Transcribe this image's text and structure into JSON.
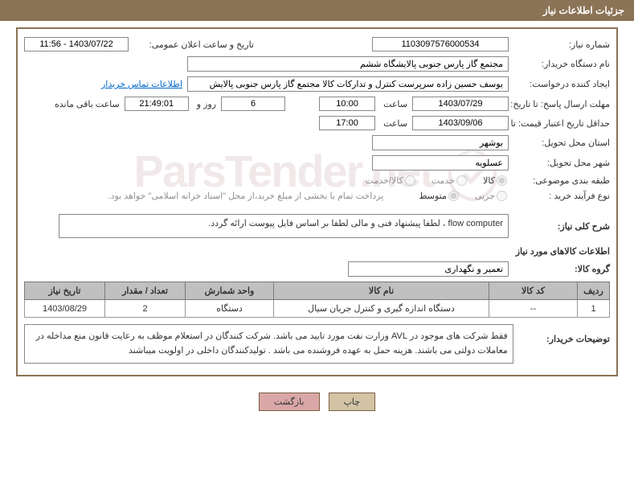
{
  "header": "جزئیات اطلاعات نیاز",
  "labels": {
    "req_no": "شماره نیاز:",
    "announce": "تاریخ و ساعت اعلان عمومی:",
    "buyer_org": "نام دستگاه خریدار:",
    "creator": "ایجاد کننده درخواست:",
    "buyer_contact": "اطلاعات تماس خریدار",
    "resp_until": "مهلت ارسال پاسخ: تا تاریخ:",
    "time": "ساعت",
    "days_and": "روز و",
    "remaining": "ساعت باقی مانده",
    "valid_until": "حداقل تاریخ اعتبار قیمت: تا تاریخ:",
    "deliv_prov": "استان محل تحویل:",
    "deliv_city": "شهر محل تحویل:",
    "subject_class": "طبقه بندی موضوعی:",
    "purchase_type": "نوع فرآیند خرید :",
    "pay_note": "پرداخت تمام یا بخشی از مبلغ خرید،از محل \"اسناد خزانه اسلامی\" خواهد بود.",
    "need_desc": "شرح کلی نیاز:",
    "goods_info": "اطلاعات کالاهای مورد نیاز",
    "goods_group": "گروه کالا:",
    "buyer_notes": "توضیحات خریدار:"
  },
  "fields": {
    "req_no": "1103097576000534",
    "announce": "1403/07/22 - 11:56",
    "buyer_org": "مجتمع گاز پارس جنوبی  پالایشگاه ششم",
    "creator": "یوسف حسین زاده سرپرست کنترل و تدارکات کالا مجتمع گاز پارس جنوبی  پالایش",
    "resp_date": "1403/07/29",
    "resp_time": "10:00",
    "days": "6",
    "countdown": "21:49:01",
    "valid_date": "1403/09/06",
    "valid_time": "17:00",
    "province": "بوشهر",
    "city": "عسلویه",
    "goods_group": "تعمیر و نگهداری",
    "need_desc": "flow computer ، لطفا پیشنهاد فنی و مالی لطفا بر اساس فایل پیوست ارائه گردد.",
    "buyer_notes": "فقط شرکت های موجود در AVL وزارت نفت مورد تایید می باشد. شرکت کنندگان در استعلام موظف به رعایت قانون منع مداخله در معاملات دولتی می باشند. هزینه حمل به عهده فروشنده می باشد . تولیدکنندگان داخلی در اولویت میباشند"
  },
  "radios": {
    "kala": "کالا",
    "khadamat": "خدمت",
    "kala_khadamat": "کالا/خدمت",
    "jozei": "جزیی",
    "motavaset": "متوسط"
  },
  "table": {
    "headers": {
      "row": "ردیف",
      "code": "کد کالا",
      "name": "نام کالا",
      "unit": "واحد شمارش",
      "qty": "تعداد / مقدار",
      "date": "تاریخ نیاز"
    },
    "rows": [
      {
        "row": "1",
        "code": "--",
        "name": "دستگاه اندازه گیری و کنترل جریان سیال",
        "unit": "دستگاه",
        "qty": "2",
        "date": "1403/08/29"
      }
    ]
  },
  "buttons": {
    "print": "چاپ",
    "back": "بازگشت"
  },
  "watermark": "ParsTender.net"
}
